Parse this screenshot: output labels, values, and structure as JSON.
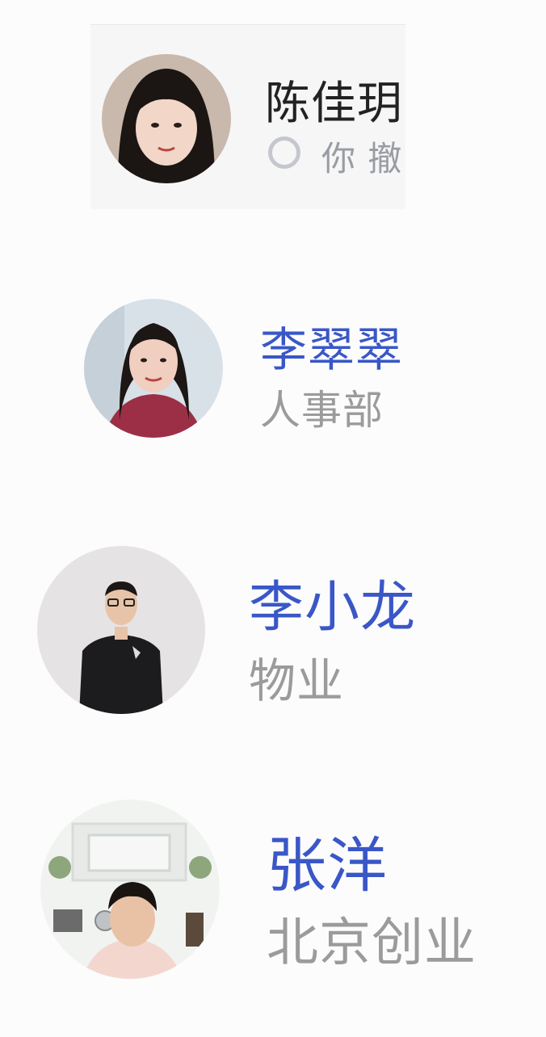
{
  "contacts": [
    {
      "name": "陈佳玥",
      "status_text": "你 撤"
    },
    {
      "name": "李翠翠",
      "department": "人事部"
    },
    {
      "name": "李小龙",
      "department": "物业"
    },
    {
      "name": "张洋",
      "department": "北京创业"
    }
  ],
  "colors": {
    "name_highlight": "#3a57c7",
    "name_default": "#222222",
    "subtitle": "#9b9b9b",
    "background": "#fcfcfd"
  }
}
